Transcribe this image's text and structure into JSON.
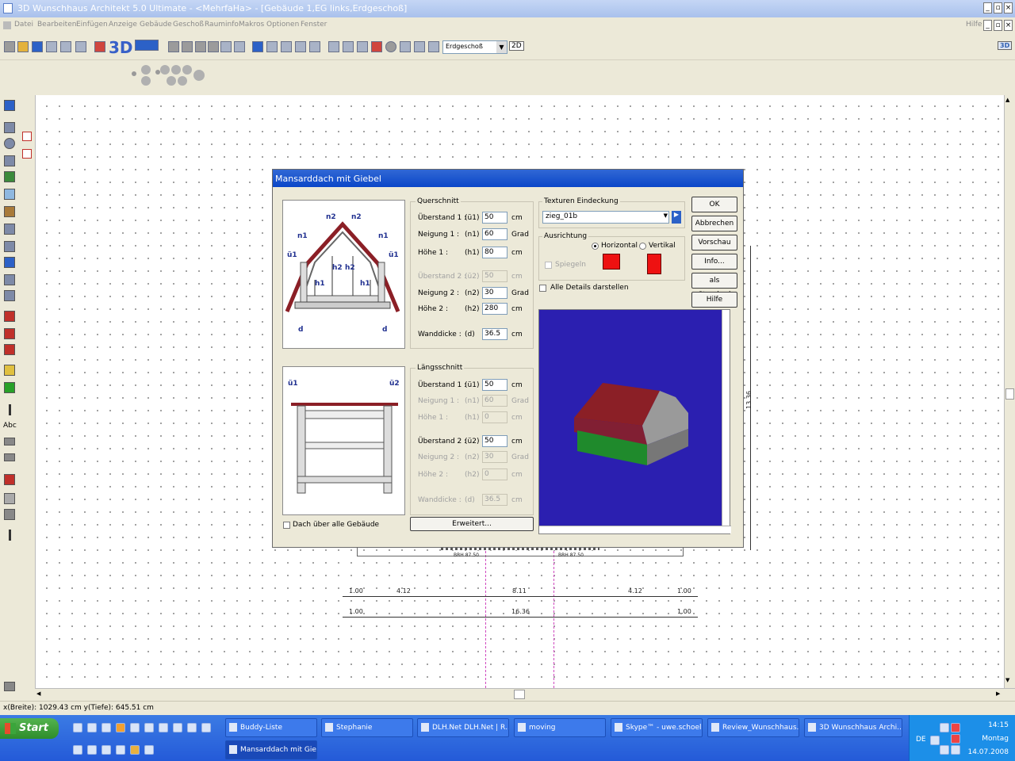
{
  "window": {
    "title": "3D Wunschhaus Architekt 5.0 Ultimate - <MehrfaHa> - [Gebäude 1,EG links,Erdgeschoß]"
  },
  "menu": [
    "Datei",
    "Bearbeiten",
    "Einfügen",
    "Anzeige",
    "Gebäude",
    "Geschoß",
    "Rauminfo",
    "Makros",
    "Optionen",
    "Fenster"
  ],
  "menu_help": "Hilfe",
  "toolbar": {
    "logo_3d": "3D",
    "floor_value": "Erdgeschoß",
    "view_2d": "2D",
    "view_3d": "3D"
  },
  "left_palette": {
    "abc_label": "Abc"
  },
  "status": {
    "coords": "x(Breite): 1029.43 cm  y(Tiefe): 645.51 cm"
  },
  "drawing": {
    "dims_top": [
      "1.00",
      "4.12",
      "8.11",
      "4.12",
      "1.00"
    ],
    "dims_bottom": [
      "1.00",
      "16.36",
      "1.00"
    ],
    "dim_vertical": "13.36",
    "small_labels": [
      "BRH 87.50",
      "BRH 87.50"
    ]
  },
  "dialog": {
    "title": "Mansarddach mit Giebel",
    "querschnitt": {
      "title": "Querschnitt",
      "rows": [
        {
          "label": "Überstand 1 :",
          "code": "(ü1)",
          "value": "50",
          "unit": "cm",
          "enabled": true
        },
        {
          "label": "Neigung 1 :",
          "code": "(n1)",
          "value": "60",
          "unit": "Grad",
          "enabled": true
        },
        {
          "label": "Höhe 1 :",
          "code": "(h1)",
          "value": "80",
          "unit": "cm",
          "enabled": true
        },
        {
          "label": "Überstand 2 :",
          "code": "(ü2)",
          "value": "50",
          "unit": "cm",
          "enabled": false
        },
        {
          "label": "Neigung 2 :",
          "code": "(n2)",
          "value": "30",
          "unit": "Grad",
          "enabled": true
        },
        {
          "label": "Höhe 2 :",
          "code": "(h2)",
          "value": "280",
          "unit": "cm",
          "enabled": true
        },
        {
          "label": "Wanddicke :",
          "code": "(d)",
          "value": "36.5",
          "unit": "cm",
          "enabled": true
        }
      ]
    },
    "laengsschnitt": {
      "title": "Längsschnitt",
      "rows": [
        {
          "label": "Überstand 1 :",
          "code": "(ü1)",
          "value": "50",
          "unit": "cm",
          "enabled": true
        },
        {
          "label": "Neigung 1 :",
          "code": "(n1)",
          "value": "60",
          "unit": "Grad",
          "enabled": false
        },
        {
          "label": "Höhe 1 :",
          "code": "(h1)",
          "value": "0",
          "unit": "cm",
          "enabled": false
        },
        {
          "label": "Überstand 2 :",
          "code": "(ü2)",
          "value": "50",
          "unit": "cm",
          "enabled": true
        },
        {
          "label": "Neigung 2 :",
          "code": "(n2)",
          "value": "30",
          "unit": "Grad",
          "enabled": false
        },
        {
          "label": "Höhe 2 :",
          "code": "(h2)",
          "value": "0",
          "unit": "cm",
          "enabled": false
        },
        {
          "label": "Wanddicke :",
          "code": "(d)",
          "value": "36.5",
          "unit": "cm",
          "enabled": false
        }
      ]
    },
    "diagram_labels": {
      "cross": [
        "n2",
        "n2",
        "n1",
        "n1",
        "ü1",
        "ü1",
        "h2",
        "h2",
        "h1",
        "h1",
        "d",
        "d"
      ],
      "long": [
        "ü1",
        "ü2"
      ]
    },
    "textures": {
      "title": "Texturen Eindeckung",
      "value": "zieg_01b"
    },
    "ausrichtung": {
      "title": "Ausrichtung",
      "horizontal": "Horizontal",
      "vertikal": "Vertikal",
      "spiegeln": "Spiegeln",
      "selected": "Horizontal"
    },
    "alle_details": "Alle Details darstellen",
    "dach_alle": "Dach über alle Gebäude",
    "erweitert": "Erweitert...",
    "buttons": [
      "OK",
      "Abbrechen",
      "Vorschau",
      "Info...",
      "als Standard",
      "Hilfe"
    ],
    "colors": {
      "roof": "#8b1f26",
      "wall_green": "#1f8a2c",
      "gable": "#9a9a9a",
      "preview_bg": "#2b1fb0"
    }
  },
  "taskbar": {
    "start": "Start",
    "tasks": [
      "Buddy-Liste",
      "Stephanie",
      "DLH.Net DLH.Net | R...",
      "moving",
      "Skype™ - uwe.schoeler",
      "Review_Wunschhaus...",
      "3D Wunschhaus Archi...",
      "Mansarddach mit Giebel"
    ],
    "lang": "DE",
    "time": "14:15",
    "day": "Montag",
    "date": "14.07.2008"
  }
}
